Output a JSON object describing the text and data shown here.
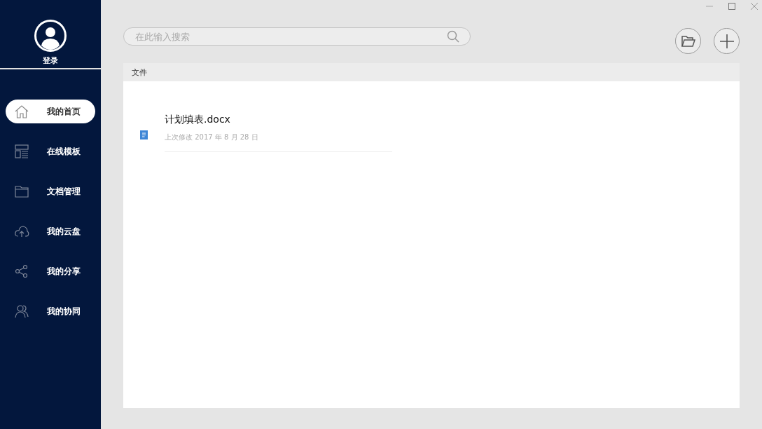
{
  "user": {
    "login_label": "登录"
  },
  "nav": [
    {
      "kind": "home",
      "label": "我的首页",
      "selected": true
    },
    {
      "kind": "template",
      "label": "在线模板",
      "selected": false
    },
    {
      "kind": "folder",
      "label": "文档管理",
      "selected": false
    },
    {
      "kind": "cloud",
      "label": "我的云盘",
      "selected": false
    },
    {
      "kind": "share",
      "label": "我的分享",
      "selected": false
    },
    {
      "kind": "collab",
      "label": "我的协同",
      "selected": false
    }
  ],
  "search": {
    "placeholder": "在此输入搜索"
  },
  "files": {
    "header": "文件",
    "items": [
      {
        "name": "计划填表.docx",
        "modified": "上次修改 2017 年 8 月 28 日"
      }
    ]
  }
}
